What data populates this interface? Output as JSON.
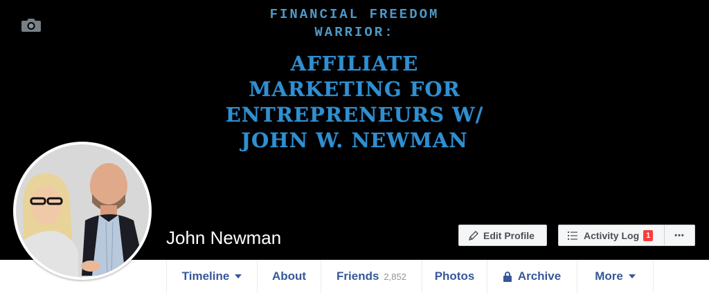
{
  "cover": {
    "subtitle": [
      "FINANCIAL FREEDOM",
      "WARRIOR:"
    ],
    "title": [
      "AFFILIATE",
      "MARKETING FOR",
      "ENTREPRENEURS W/",
      "JOHN W. NEWMAN"
    ],
    "background_color": "#000000",
    "text_color": "#2f8fd0",
    "camera_icon": "camera-icon"
  },
  "profile": {
    "name": "John Newman"
  },
  "actions": {
    "edit_profile_label": "Edit Profile",
    "activity_log_label": "Activity Log",
    "activity_log_badge": "1",
    "more_options_label": "•••"
  },
  "tabs": [
    {
      "label": "Timeline"
    },
    {
      "label": "About"
    },
    {
      "label": "Friends",
      "count": "2,852"
    },
    {
      "label": "Photos"
    },
    {
      "label": "Archive"
    },
    {
      "label": "More"
    }
  ],
  "colors": {
    "link": "#365899",
    "badge": "#fa3e3e"
  }
}
